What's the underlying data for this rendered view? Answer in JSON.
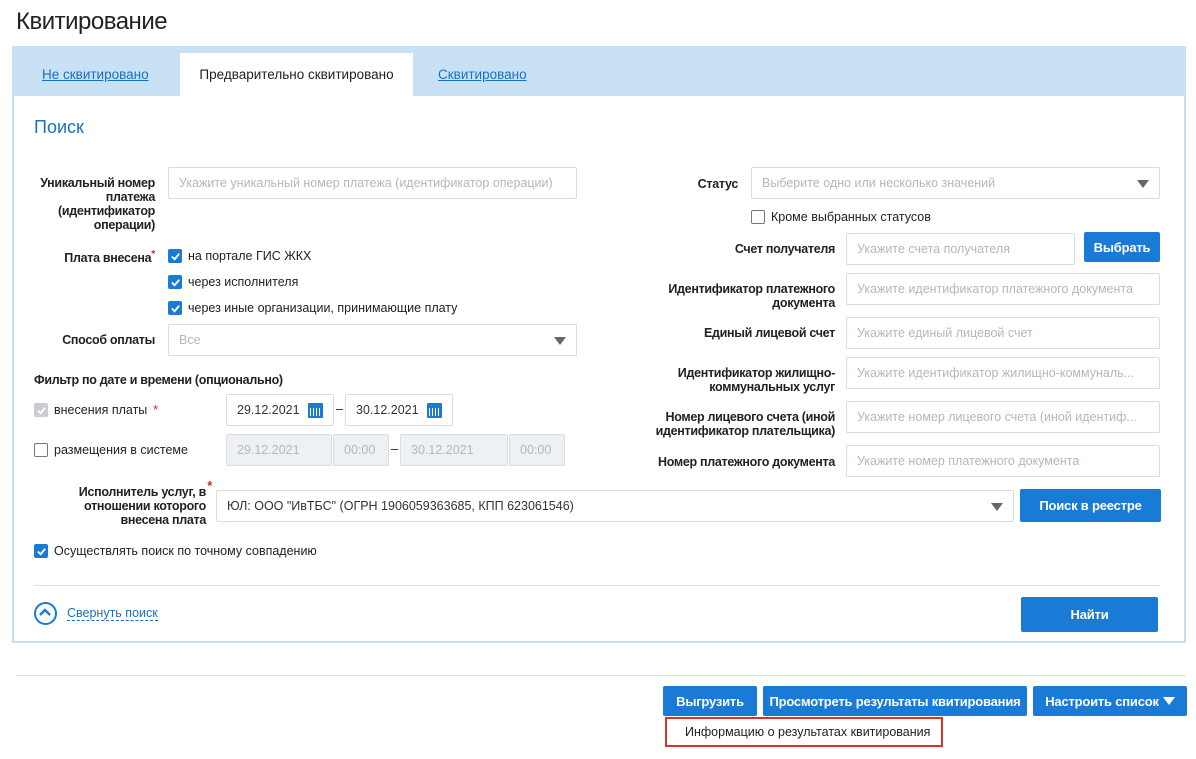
{
  "title": "Квитирование",
  "tabs": [
    {
      "label": "Не сквитировано"
    },
    {
      "label": "Предварительно сквитировано"
    },
    {
      "label": "Сквитировано"
    }
  ],
  "search": {
    "heading": "Поиск",
    "unique_number": {
      "label": "Уникальный номер платежа (идентификатор операции)",
      "placeholder": "Укажите уникальный номер платежа (идентификатор операции)"
    },
    "paid_via": {
      "label": "Плата внесена",
      "required": "*",
      "options": [
        {
          "label": "на портале ГИС ЖКХ",
          "checked": true
        },
        {
          "label": "через исполнителя",
          "checked": true
        },
        {
          "label": "через иные организации, принимающие плату",
          "checked": true
        }
      ]
    },
    "payment_method": {
      "label": "Способ оплаты",
      "value": "Все"
    },
    "date_filter": {
      "heading": "Фильтр по дате и времени (опционально)",
      "payment": {
        "label": "внесения платы",
        "required": "*",
        "from": "29.12.2021",
        "to": "30.12.2021",
        "dash": "–"
      },
      "placement": {
        "label": "размещения в системе",
        "from": "29.12.2021",
        "from_time": "00:00",
        "to": "30.12.2021",
        "to_time": "00:00",
        "dash": "–"
      }
    },
    "status": {
      "label": "Статус",
      "placeholder": "Выберите одно или несколько значений",
      "except_label": "Кроме выбранных статусов"
    },
    "recipient_account": {
      "label": "Счет получателя",
      "placeholder": "Укажите счета получателя",
      "button": "Выбрать"
    },
    "payment_doc_id": {
      "label": "Идентификатор платежного документа",
      "placeholder": "Укажите идентификатор платежного документа"
    },
    "single_account": {
      "label": "Единый лицевой счет",
      "placeholder": "Укажите единый лицевой счет"
    },
    "hcs_id": {
      "label": "Идентификатор жилищно-коммунальных услуг",
      "placeholder": "Укажите идентификатор жилищно-коммуналь..."
    },
    "personal_account": {
      "label": "Номер лицевого счета (иной идентификатор плательщика)",
      "placeholder": "Укажите номер лицевого счета (иной идентиф..."
    },
    "payment_doc_number": {
      "label": "Номер платежного документа",
      "placeholder": "Укажите номер платежного документа"
    },
    "executor": {
      "label": "Исполнитель услуг, в отношении которого внесена плата",
      "required": "*",
      "value": "ЮЛ: ООО \"ИвТБС\" (ОГРН 1906059363685, КПП 623061546)",
      "button": "Поиск в реестре"
    },
    "exact_match": {
      "label": "Осуществлять поиск по точному совпадению",
      "checked": true
    },
    "collapse_label": "Свернуть поиск",
    "find_button": "Найти"
  },
  "actions": {
    "export": "Выгрузить",
    "view_results": "Просмотреть результаты квитирования",
    "configure": "Настроить список",
    "dropdown_item": "Информацию о результатах квитирования"
  },
  "colors": {
    "accent": "#1a7bd6",
    "tabbar": "#c8e1f5",
    "highlight": "#d9342b"
  }
}
